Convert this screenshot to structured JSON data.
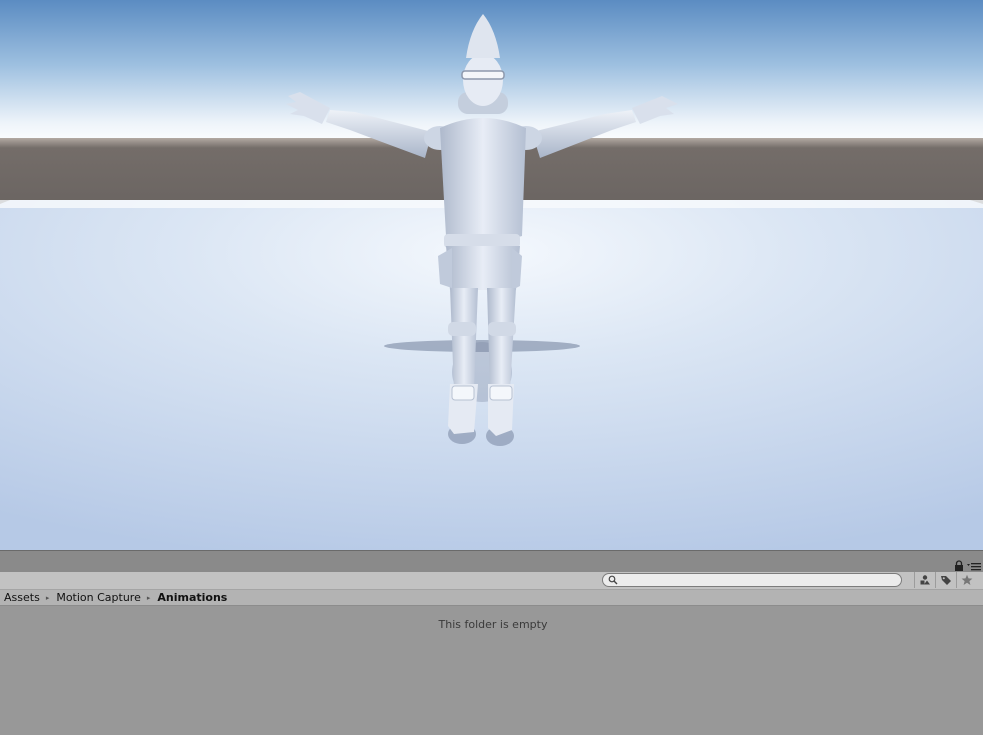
{
  "breadcrumb": {
    "items": [
      {
        "label": "Assets"
      },
      {
        "label": "Motion Capture"
      },
      {
        "label": "Animations"
      }
    ],
    "separator": "▸"
  },
  "search": {
    "value": "",
    "placeholder": ""
  },
  "folder": {
    "empty_message": "This folder is empty"
  },
  "toolbar": {
    "buttons": [
      {
        "icon": "create-icon"
      },
      {
        "icon": "tag-icon"
      },
      {
        "icon": "star-icon"
      }
    ]
  },
  "colors": {
    "sky_top": "#5f8fc4",
    "horizon": "#ffffff",
    "ground_band": "#6f6966",
    "floor": "#c8d8ee",
    "panel_bg": "#989898"
  }
}
